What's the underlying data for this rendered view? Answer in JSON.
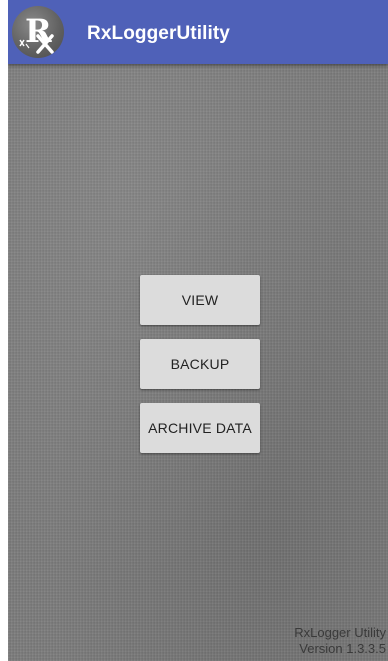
{
  "app_bar": {
    "title": "RxLoggerUtility",
    "logo_icon": "rx-logo-icon",
    "color": "#4f61b8"
  },
  "actions": {
    "view_label": "VIEW",
    "backup_label": "BACKUP",
    "archive_label": "ARCHIVE DATA"
  },
  "footer": {
    "app_name": "RxLogger Utility",
    "version": "Version 1.3.3.5"
  }
}
